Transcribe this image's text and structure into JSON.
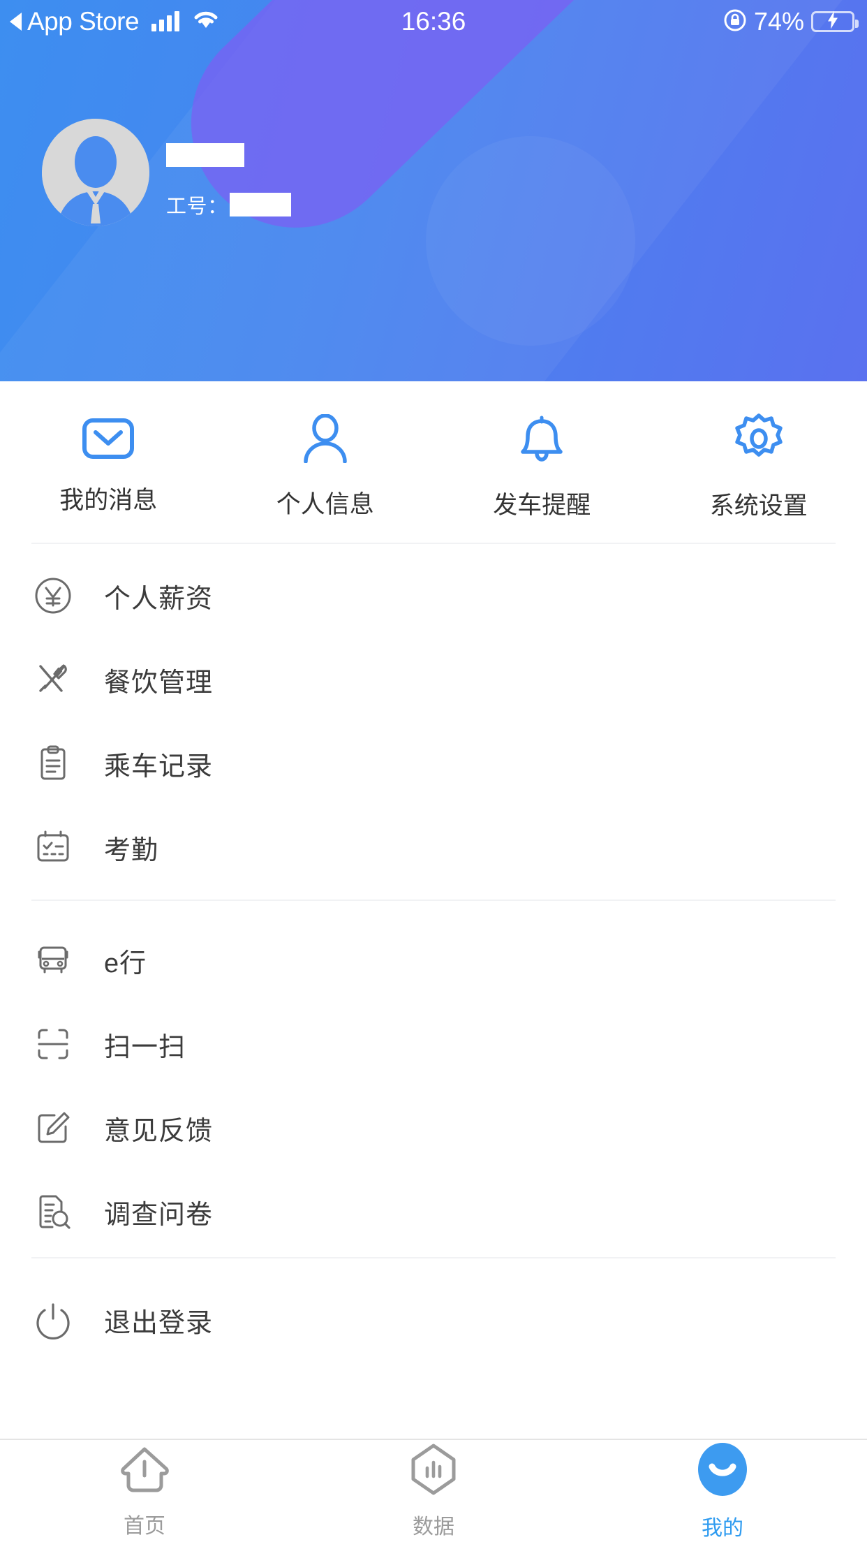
{
  "status_bar": {
    "back_app": "App Store",
    "back_arrow_icon": "triangle-left-icon",
    "signal_icon": "cellular-signal-icon",
    "wifi_icon": "wifi-icon",
    "time": "16:36",
    "rotation_lock_icon": "rotation-lock-icon",
    "battery_percent": "74%",
    "battery_level": 74,
    "battery_icon": "battery-charging-icon"
  },
  "header": {
    "avatar_icon": "user-avatar-placeholder",
    "name": "",
    "employee_id_label": "工号：",
    "employee_id": "",
    "gradient_from": "#3d8ef0",
    "gradient_to": "#5a71ef",
    "stripe_color": "#7c5ef2"
  },
  "quick_actions": {
    "accent_color": "#3d8ef0",
    "items": [
      {
        "label": "我的消息",
        "icon": "envelope-icon"
      },
      {
        "label": "个人信息",
        "icon": "person-icon"
      },
      {
        "label": "发车提醒",
        "icon": "bell-icon"
      },
      {
        "label": "系统设置",
        "icon": "gear-icon"
      }
    ]
  },
  "menu_groups": [
    {
      "items": [
        {
          "label": "个人薪资",
          "icon": "yuan-circle-icon"
        },
        {
          "label": "餐饮管理",
          "icon": "fork-knife-icon"
        },
        {
          "label": "乘车记录",
          "icon": "clipboard-icon"
        },
        {
          "label": "考勤",
          "icon": "calendar-check-icon"
        }
      ]
    },
    {
      "items": [
        {
          "label": "e行",
          "icon": "bus-icon"
        },
        {
          "label": "扫一扫",
          "icon": "scan-icon"
        },
        {
          "label": "意见反馈",
          "icon": "edit-square-icon"
        },
        {
          "label": "调查问卷",
          "icon": "document-search-icon"
        }
      ]
    },
    {
      "items": [
        {
          "label": "退出登录",
          "icon": "power-icon"
        }
      ]
    }
  ],
  "tab_bar": {
    "active_color": "#2e9bf0",
    "inactive_color": "#9b9b9b",
    "tabs": [
      {
        "label": "首页",
        "icon": "home-icon",
        "active": false
      },
      {
        "label": "数据",
        "icon": "data-hexagon-icon",
        "active": false
      },
      {
        "label": "我的",
        "icon": "smile-face-icon",
        "active": true
      }
    ]
  }
}
